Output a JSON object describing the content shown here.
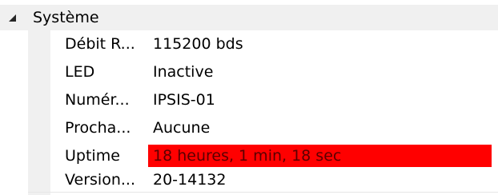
{
  "category": {
    "label": "Système",
    "expander_icon": "triangle-expanded-icon"
  },
  "properties": [
    {
      "name": "Débit R...",
      "value": "115200 bds"
    },
    {
      "name": "LED",
      "value": "Inactive"
    },
    {
      "name": "Numér...",
      "value": "IPSIS-01"
    },
    {
      "name": "Procha...",
      "value": "Aucune"
    },
    {
      "name": "Uptime",
      "value": "18 heures, 1 min, 18 sec",
      "highlight_color": "#ff0000"
    },
    {
      "name": "Version...",
      "value": "20-14132"
    }
  ]
}
